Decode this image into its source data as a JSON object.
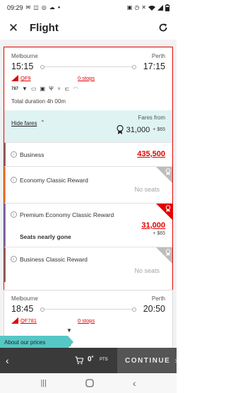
{
  "status_bar": {
    "time": "09:29",
    "left_icons": [
      "message-icon",
      "cast-icon",
      "whatsapp-icon",
      "cloud-icon",
      "dot-icon"
    ],
    "right_icons": [
      "battery-saver-icon",
      "alarm-icon",
      "mute-icon",
      "wifi-icon",
      "signal-icon",
      "battery-icon"
    ]
  },
  "header": {
    "title": "Flight"
  },
  "flights": [
    {
      "origin": "Melbourne",
      "destination": "Perth",
      "depart": "15:15",
      "arrive": "17:15",
      "flight_number": "QF9",
      "stops": "0 stops",
      "amenities": [
        "aircraft-787-icon",
        "drinks-icon",
        "meal-icon",
        "dining-icon",
        "cutlery-icon",
        "wine-icon",
        "seat-icon",
        "wifi-icon"
      ],
      "duration": "Total duration 4h 00m",
      "hide_fares": "Hide fares",
      "fares_from_label": "Fares from",
      "fares_from_points": "31,000",
      "fares_from_cash": "+ $65",
      "fares": [
        {
          "name": "Business",
          "price": "435,500",
          "accent": "#777777",
          "info": "i"
        },
        {
          "name": "Economy Classic Reward",
          "status": "No seats",
          "accent": "#e8a347",
          "info": "i",
          "corner": "#bdbdbd"
        },
        {
          "name": "Premium Economy Classic Reward",
          "price": "31,000",
          "cash": "+ $65",
          "note": "Seats nearly gone",
          "accent": "#5a8bd6",
          "info": "i",
          "corner": "#e40000"
        },
        {
          "name": "Business Classic Reward",
          "status": "No seats",
          "accent": "#777777",
          "info": "i",
          "corner": "#bdbdbd"
        }
      ]
    },
    {
      "origin": "Melbourne",
      "destination": "Perth",
      "depart": "18:45",
      "arrive": "20:50",
      "flight_number": "QF781",
      "stops": "0 stops",
      "duration_tail": "m"
    }
  ],
  "about_prices": "About our prices",
  "bottom_bar": {
    "points_value": "0",
    "points_suffix": "*",
    "points_label": "PTS",
    "continue_label": "CONTINUE"
  },
  "colors": {
    "brand_red": "#e40000",
    "teal": "#55c7c5",
    "fares_bg": "#dff3f3"
  }
}
